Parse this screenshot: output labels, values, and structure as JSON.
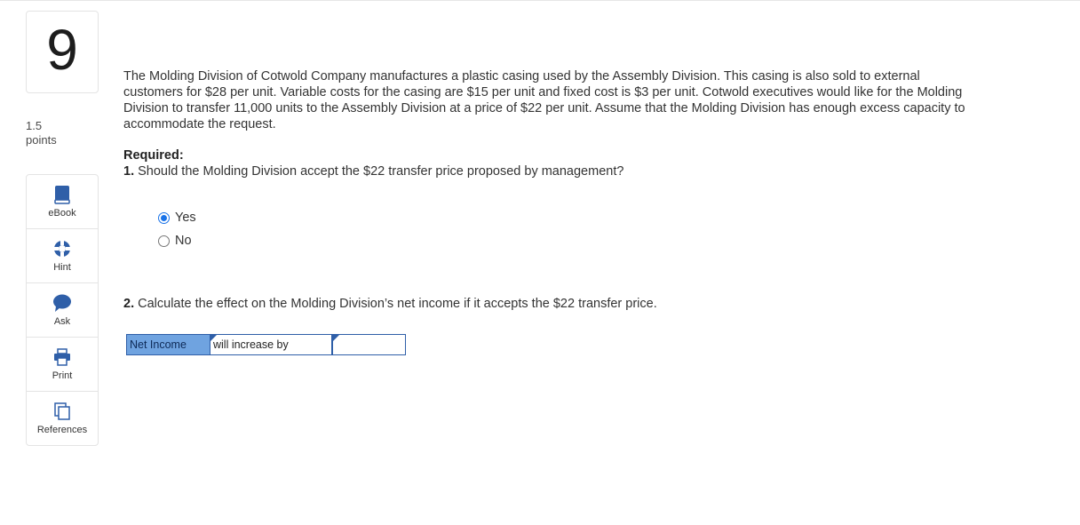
{
  "question": {
    "number": "9",
    "points_value": "1.5",
    "points_label": "points"
  },
  "tools": [
    {
      "label": "eBook",
      "icon": "book-icon"
    },
    {
      "label": "Hint",
      "icon": "lifebuoy-icon"
    },
    {
      "label": "Ask",
      "icon": "speech-bubble-icon"
    },
    {
      "label": "Print",
      "icon": "printer-icon"
    },
    {
      "label": "References",
      "icon": "documents-icon"
    }
  ],
  "problem": {
    "text": "The Molding Division of Cotwold Company manufactures a plastic casing used by the Assembly Division. This casing is also sold to external customers for $28 per unit. Variable costs for the casing are $15 per unit and fixed cost is $3 per unit. Cotwold executives would like for the Molding Division to transfer 11,000 units to the Assembly Division at a price of $22 per unit. Assume that the Molding Division has enough excess capacity to accommodate the request.",
    "required_label": "Required:",
    "q1_number": "1.",
    "q1_text": " Should the Molding Division accept the $22 transfer price proposed by management?",
    "options": [
      {
        "label": "Yes",
        "selected": true
      },
      {
        "label": "No",
        "selected": false
      }
    ],
    "q2_number": "2.",
    "q2_text": " Calculate the effect on the Molding Division’s net income if it accepts the $22 transfer price."
  },
  "answer_row": {
    "label": "Net Income",
    "select_value": "will increase by",
    "input_value": ""
  },
  "colors": {
    "accent": "#1a73e8",
    "table_header": "#6fa3e0",
    "table_border": "#2f5fa8"
  }
}
